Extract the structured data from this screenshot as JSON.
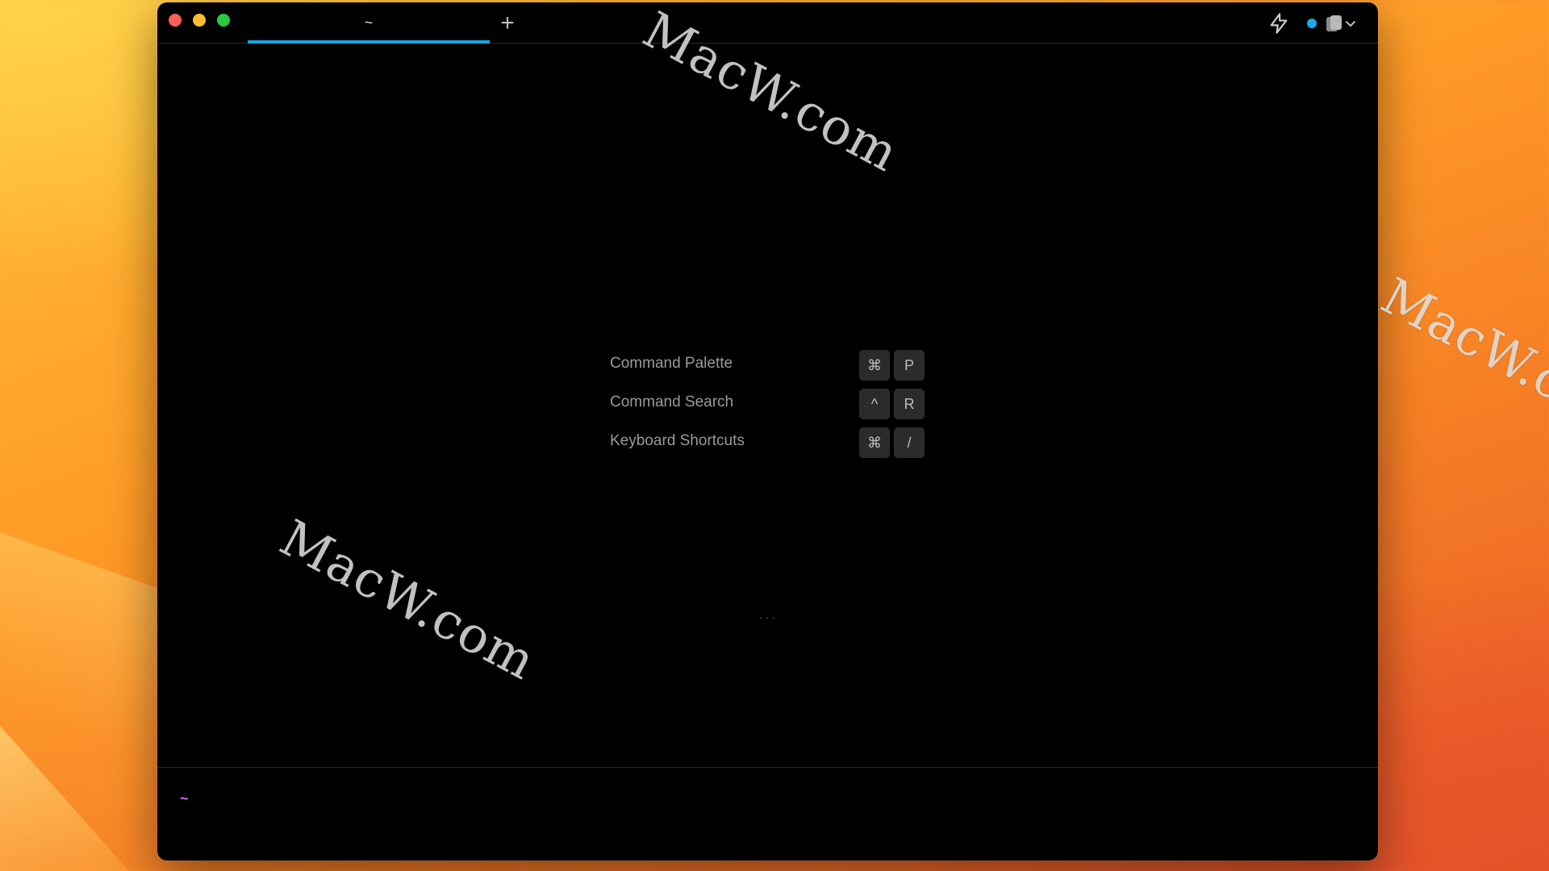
{
  "window": {
    "tab_title": "~",
    "new_tab_symbol": "+",
    "accent_color": "#19a5e4"
  },
  "shortcuts": [
    {
      "label": "Command Palette",
      "keys": [
        "⌘",
        "P"
      ]
    },
    {
      "label": "Command Search",
      "keys": [
        "^",
        "R"
      ]
    },
    {
      "label": "Keyboard Shortcuts",
      "keys": [
        "⌘",
        "/"
      ]
    }
  ],
  "loading_dots": "···",
  "input": {
    "prompt": "~",
    "prompt_color": "#d86cf0"
  },
  "icons": {
    "bolt": "bolt-icon",
    "profile": "profile-icon",
    "chevron": "chevron-down-icon"
  },
  "watermark_text": "MacW.com"
}
